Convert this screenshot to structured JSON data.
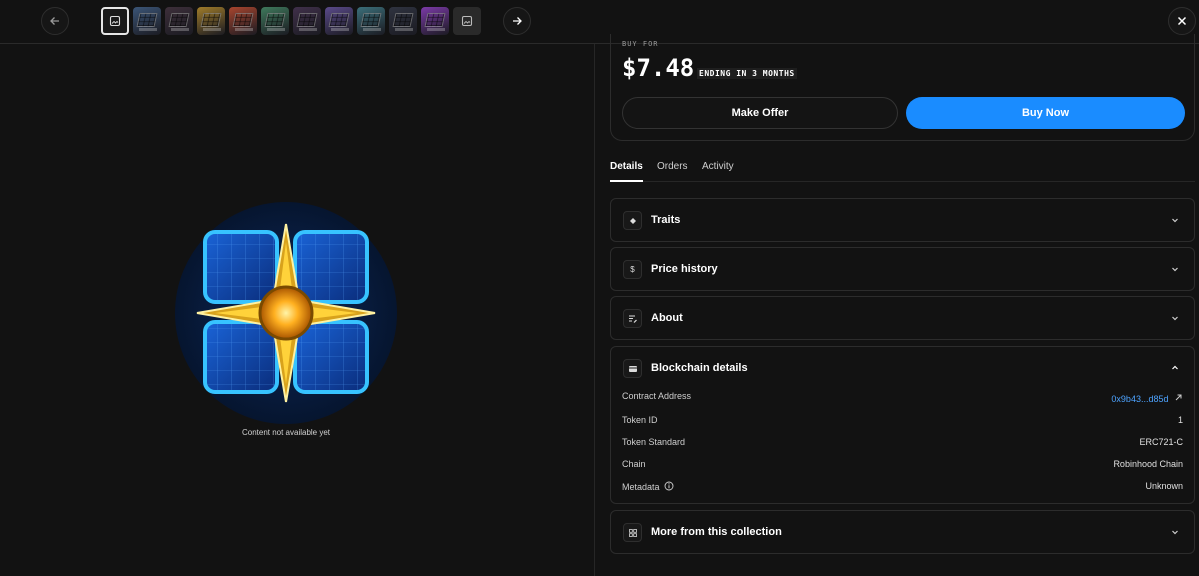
{
  "nav": {
    "thumbnails": [
      {
        "kind": "selected"
      },
      {
        "kind": "art",
        "color": "#3b5577"
      },
      {
        "kind": "art",
        "color": "#3d2f3a"
      },
      {
        "kind": "art",
        "color": "#a07c2a"
      },
      {
        "kind": "art",
        "color": "#a8452e"
      },
      {
        "kind": "art",
        "color": "#3f7a5c"
      },
      {
        "kind": "art",
        "color": "#40304a"
      },
      {
        "kind": "art",
        "color": "#5a4a8a"
      },
      {
        "kind": "art",
        "color": "#3b6f7a"
      },
      {
        "kind": "art",
        "color": "#2f3340"
      },
      {
        "kind": "art",
        "color": "#7c3aa8"
      },
      {
        "kind": "placeholder"
      }
    ]
  },
  "media": {
    "caption": "Content not available yet"
  },
  "listing": {
    "buy_for_label": "BUY FOR",
    "price": "$7.48",
    "ending": "ENDING IN 3 MONTHS",
    "make_offer_label": "Make Offer",
    "buy_now_label": "Buy Now"
  },
  "tabs": [
    {
      "label": "Details",
      "active": true
    },
    {
      "label": "Orders",
      "active": false
    },
    {
      "label": "Activity",
      "active": false
    }
  ],
  "sections": {
    "traits": {
      "title": "Traits",
      "icon": "diamond-icon"
    },
    "price_history": {
      "title": "Price history",
      "icon": "dollar-icon"
    },
    "about": {
      "title": "About",
      "icon": "text-edit-icon"
    },
    "blockchain": {
      "title": "Blockchain details",
      "icon": "card-icon"
    },
    "more": {
      "title": "More from this collection",
      "icon": "grid-icon"
    }
  },
  "blockchain_details": [
    {
      "key": "Contract Address",
      "value": "0x9b43...d85d",
      "link": true
    },
    {
      "key": "Token ID",
      "value": "1",
      "link": false
    },
    {
      "key": "Token Standard",
      "value": "ERC721-C",
      "link": false
    },
    {
      "key": "Chain",
      "value": "Robinhood Chain",
      "link": false
    },
    {
      "key": "Metadata",
      "value": "Unknown",
      "link": false
    }
  ],
  "colors": {
    "accent": "#1a8cff",
    "link": "#4da3ff",
    "background": "#121212"
  }
}
